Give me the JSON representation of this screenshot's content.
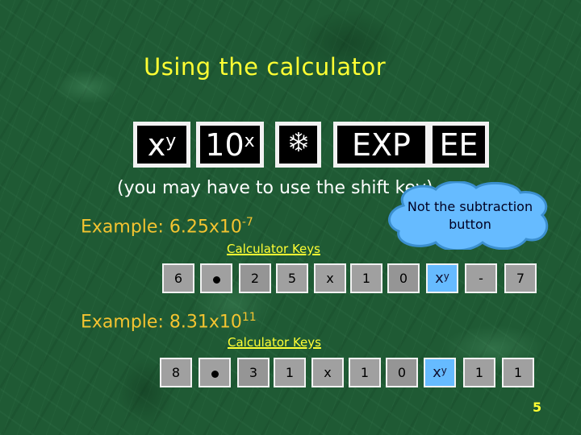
{
  "title": "Using the calculator",
  "function_keys": [
    {
      "base": "x",
      "sup": "y",
      "name": "x-power-y"
    },
    {
      "base": "10",
      "sup": "x",
      "name": "ten-power-x"
    },
    {
      "icon": "snowflake-icon",
      "glyph": "❄",
      "name": "snowflake"
    },
    {
      "base": "EXP",
      "sup": "",
      "name": "exp"
    },
    {
      "base": "EE",
      "sup": "",
      "name": "ee"
    }
  ],
  "note": "(you may have to use the shift key)",
  "callout": {
    "line1": "Not the subtraction",
    "line2": "button",
    "color": "#66bbff"
  },
  "example1": {
    "label": "Example: 6.25x10",
    "exponent": "-7",
    "link": "Calculator Keys",
    "keys": [
      "6",
      "•",
      "2",
      "5",
      "x",
      "1",
      "0",
      "xʸ",
      "-",
      "7"
    ]
  },
  "example2": {
    "label": "Example: 8.31x10",
    "exponent": "11",
    "link": "Calculator Keys",
    "keys": [
      "8",
      "•",
      "3",
      "1",
      "x",
      "1",
      "0",
      "xʸ",
      "1",
      "1"
    ]
  },
  "page_number": "5",
  "colors": {
    "title": "#ffff33",
    "example": "#f4c430",
    "key_highlight": "#66bbff",
    "background": "#1f5a34"
  }
}
